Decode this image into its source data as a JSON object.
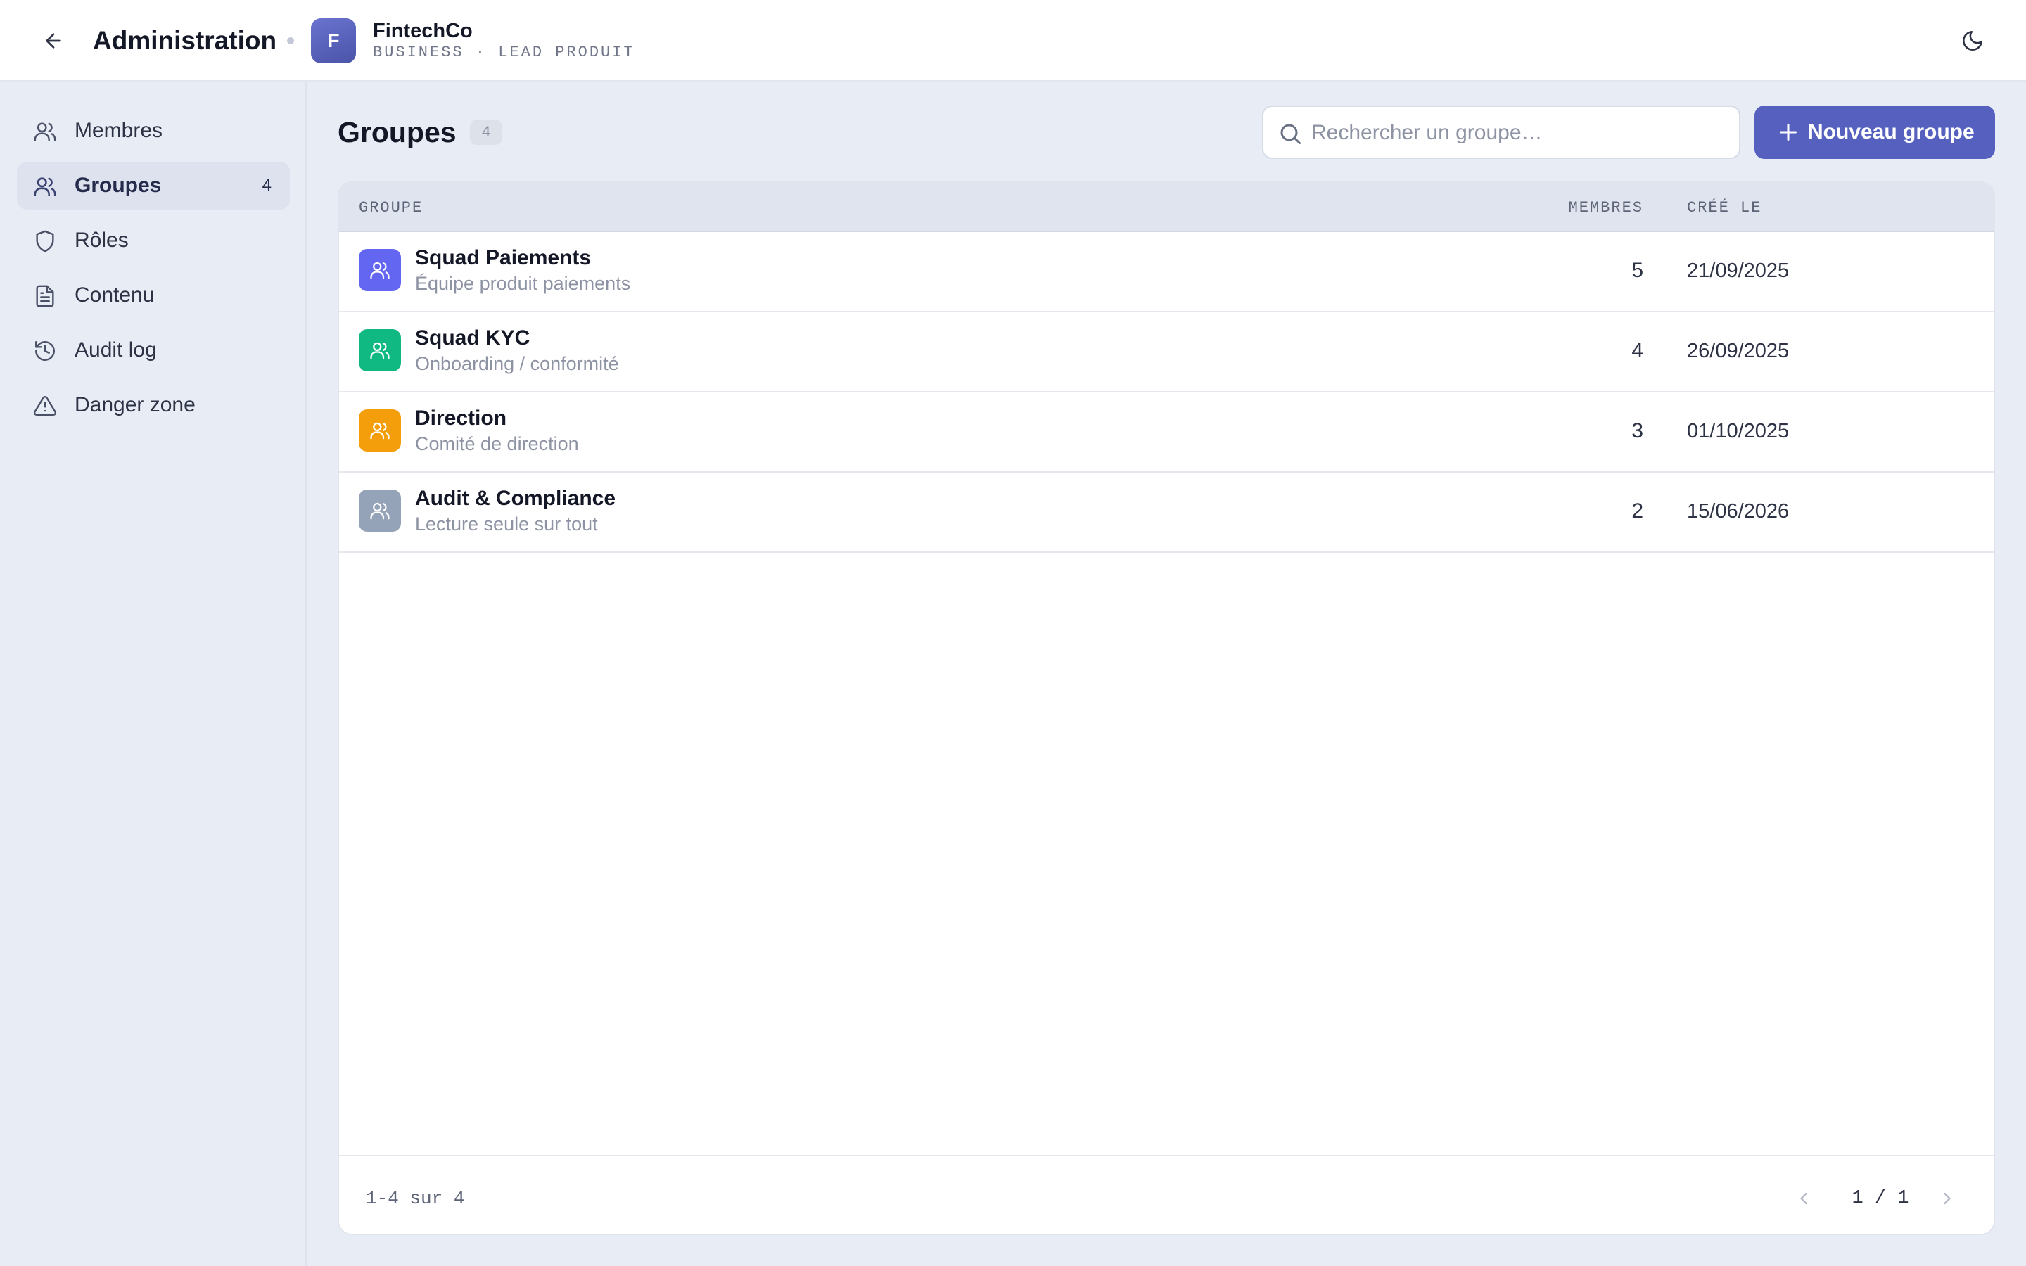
{
  "header": {
    "title": "Administration",
    "org_initial": "F",
    "org_name": "FintechCo",
    "org_subtitle": "BUSINESS · LEAD PRODUIT"
  },
  "sidebar": {
    "items": [
      {
        "label": "Membres",
        "icon": "users-icon",
        "active": false,
        "count": ""
      },
      {
        "label": "Groupes",
        "icon": "group-icon",
        "active": true,
        "count": "4"
      },
      {
        "label": "Rôles",
        "icon": "shield-icon",
        "active": false,
        "count": ""
      },
      {
        "label": "Contenu",
        "icon": "document-icon",
        "active": false,
        "count": ""
      },
      {
        "label": "Audit log",
        "icon": "history-icon",
        "active": false,
        "count": ""
      },
      {
        "label": "Danger zone",
        "icon": "warning-icon",
        "active": false,
        "count": ""
      }
    ]
  },
  "main": {
    "title": "Groupes",
    "count": "4",
    "search_placeholder": "Rechercher un groupe…",
    "new_button": "Nouveau groupe",
    "columns": {
      "group": "GROUPE",
      "members": "MEMBRES",
      "created": "CRÉÉ LE"
    },
    "rows": [
      {
        "name": "Squad Paiements",
        "description": "Équipe produit paiements",
        "members": "5",
        "created": "21/09/2025",
        "color": "#6366f1"
      },
      {
        "name": "Squad KYC",
        "description": "Onboarding / conformité",
        "members": "4",
        "created": "26/09/2025",
        "color": "#10b981"
      },
      {
        "name": "Direction",
        "description": "Comité de direction",
        "members": "3",
        "created": "01/10/2025",
        "color": "#f59e0b"
      },
      {
        "name": "Audit & Compliance",
        "description": "Lecture seule sur tout",
        "members": "2",
        "created": "15/06/2026",
        "color": "#94a3b8"
      }
    ],
    "footer": {
      "range": "1-4 sur 4",
      "page": "1 / 1"
    }
  },
  "colors": {
    "accent": "#5560bf",
    "background": "#e8ecf5"
  }
}
